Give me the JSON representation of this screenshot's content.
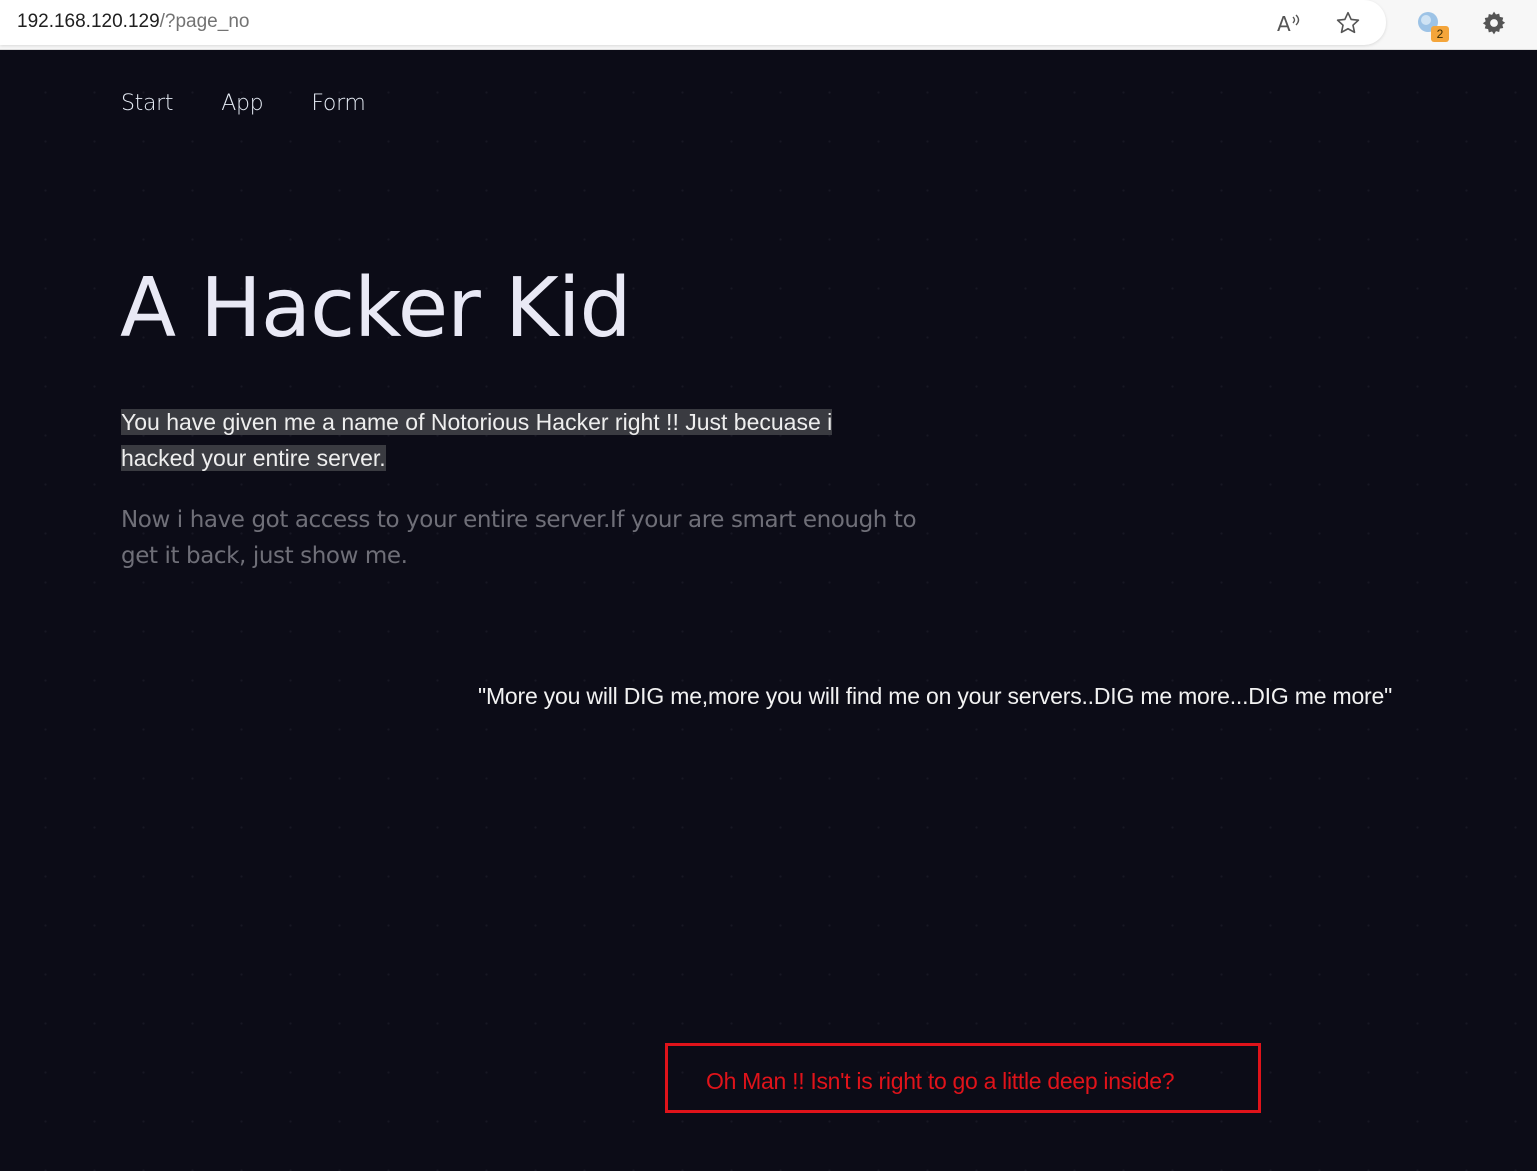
{
  "browser": {
    "url_host": "192.168.120.129",
    "url_path": "/?page_no",
    "extension_badge": "2"
  },
  "nav": {
    "items": [
      {
        "label": "Start"
      },
      {
        "label": "App"
      },
      {
        "label": "Form"
      }
    ]
  },
  "hero": {
    "title": "A Hacker Kid",
    "lead": "You have given me a name of Notorious Hacker right !! Just becuase i hacked your entire server.",
    "sub": "Now i have got access to your entire server.If your are smart enough to get it back, just show me."
  },
  "quote": "\"More you will DIG me,more you will find me on your servers..DIG me more...DIG me more\"",
  "deep_message": "Oh Man !! Isn't is right to go a little deep inside?",
  "colors": {
    "background": "#0c0c17",
    "accent_red": "#e0131a",
    "highlight": "#3a3b41"
  },
  "icons": {
    "read_aloud": "read-aloud-icon",
    "favorite": "star-icon",
    "extension": "extension-icon",
    "settings": "gear-icon"
  }
}
